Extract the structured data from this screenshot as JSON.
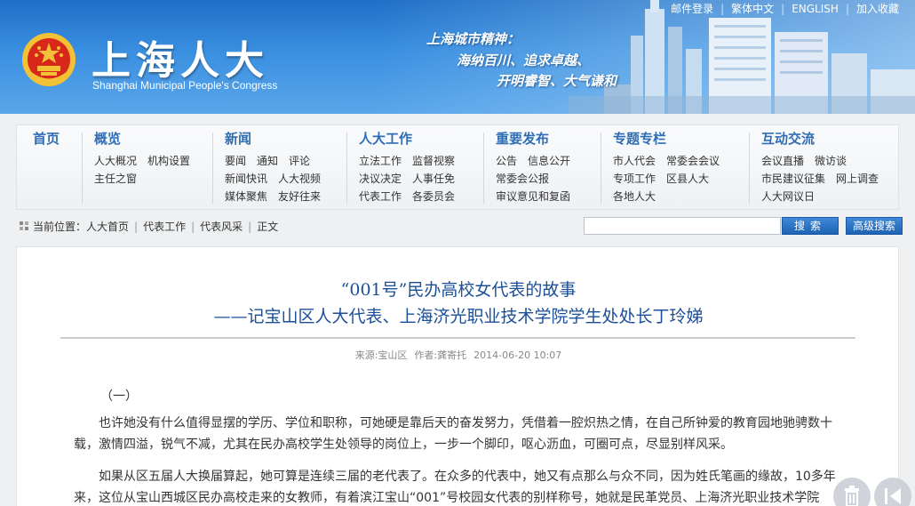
{
  "header": {
    "site_title": "上海人大",
    "site_subtitle": "Shanghai Municipal People's Congress",
    "spirit_line_1": "上海城市精神：",
    "spirit_line_2": "海纳百川、追求卓越、",
    "spirit_line_3": "开明睿智、大气谦和",
    "top_links": [
      "邮件登录",
      "繁体中文",
      "ENGLISH",
      "加入收藏"
    ],
    "colors": {
      "banner_dark": "#1f6fc7",
      "banner_light": "#5aa6ea",
      "emblem_red": "#d8281c",
      "emblem_gold": "#f3c136"
    }
  },
  "nav": {
    "home": "首页",
    "columns": [
      {
        "head": "概览",
        "items": [
          "人大概况",
          "机构设置",
          "主任之窗"
        ]
      },
      {
        "head": "新闻",
        "items": [
          "要闻",
          "通知",
          "评论",
          "新闻快讯",
          "人大视频",
          "媒体聚焦",
          "友好往来"
        ]
      },
      {
        "head": "人大工作",
        "items": [
          "立法工作",
          "监督视察",
          "决议决定",
          "人事任免",
          "代表工作",
          "各委员会"
        ]
      },
      {
        "head": "重要发布",
        "items": [
          "公告",
          "信息公开",
          "常委会公报",
          "审议意见和复函"
        ]
      },
      {
        "head": "专题专栏",
        "items": [
          "市人代会",
          "常委会会议",
          "专项工作",
          "区县人大",
          "各地人大"
        ]
      },
      {
        "head": "互动交流",
        "items": [
          "会议直播",
          "微访谈",
          "市民建议征集",
          "网上调查",
          "人大网议日"
        ]
      }
    ],
    "accent": "#2f6db5"
  },
  "breadcrumb": {
    "prefix": "当前位置：",
    "items": [
      "人大首页",
      "代表工作",
      "代表风采",
      "正文"
    ]
  },
  "search": {
    "placeholder": "",
    "search_label": "搜索",
    "advanced_label": "高级搜索"
  },
  "article": {
    "title_1": "“001号”民办高校女代表的故事",
    "title_2": "——记宝山区人大代表、上海济光职业技术学院学生处处长丁玲娣",
    "source_label": "来源:宝山区",
    "author_label": "作者:龚寄托",
    "datetime": "2014-06-20 10:07",
    "section_number": "（一）",
    "paragraph_1": "也许她没有什么值得显摆的学历、学位和职称，可她硬是靠后天的奋发努力，凭借着一腔炽热之情，在自己所钟爱的教育园地驰骋数十载，激情四溢，锐气不减，尤其在民办高校学生处领导的岗位上，一步一个脚印，呕心沥血，可圈可点，尽显别样风采。",
    "paragraph_2": "如果从区五届人大换届算起，她可算是连续三届的老代表了。在众多的代表中，她又有点那么与众不同，因为姓氏笔画的缘故，10多年来，这位从宝山西城区民办高校走来的女教师，有着滨江宝山“001”号校园女代表的别样称号，她就是民革党员、上海济光职业技术学院"
  },
  "side_tools": [
    "trash-icon",
    "prev-icon"
  ]
}
